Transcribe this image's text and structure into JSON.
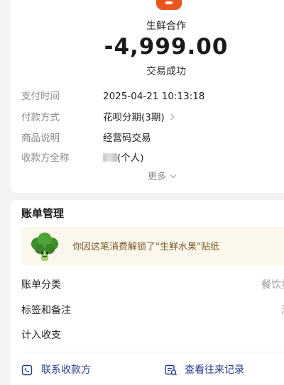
{
  "merchant": {
    "name": "生鲜合作",
    "amount": "-4,999.00",
    "status": "交易成功"
  },
  "details": [
    {
      "label": "支付时间",
      "value": "2025-04-21 10:13:18"
    },
    {
      "label": "付款方式",
      "value": "花呗分期(3期)"
    },
    {
      "label": "商品说明",
      "value": "经营码交易"
    },
    {
      "label": "收款方全称",
      "value": "(个人)"
    }
  ],
  "more_label": "更多",
  "bill_management": {
    "title": "账单管理",
    "sticker_text": "你因这笔消费解锁了\"生鲜水果\"贴纸",
    "rows": [
      {
        "label": "账单分类",
        "value": "餐饮美"
      },
      {
        "label": "标签和备注",
        "value": "添"
      },
      {
        "label": "计入收支",
        "value": ""
      }
    ]
  },
  "actions": {
    "contact": "联系收款方",
    "history": "查看往来记录"
  },
  "colors": {
    "brand_orange": "#e8581e",
    "link_blue": "#1f3a8a",
    "sticker_bg": "#fbf7ec"
  }
}
